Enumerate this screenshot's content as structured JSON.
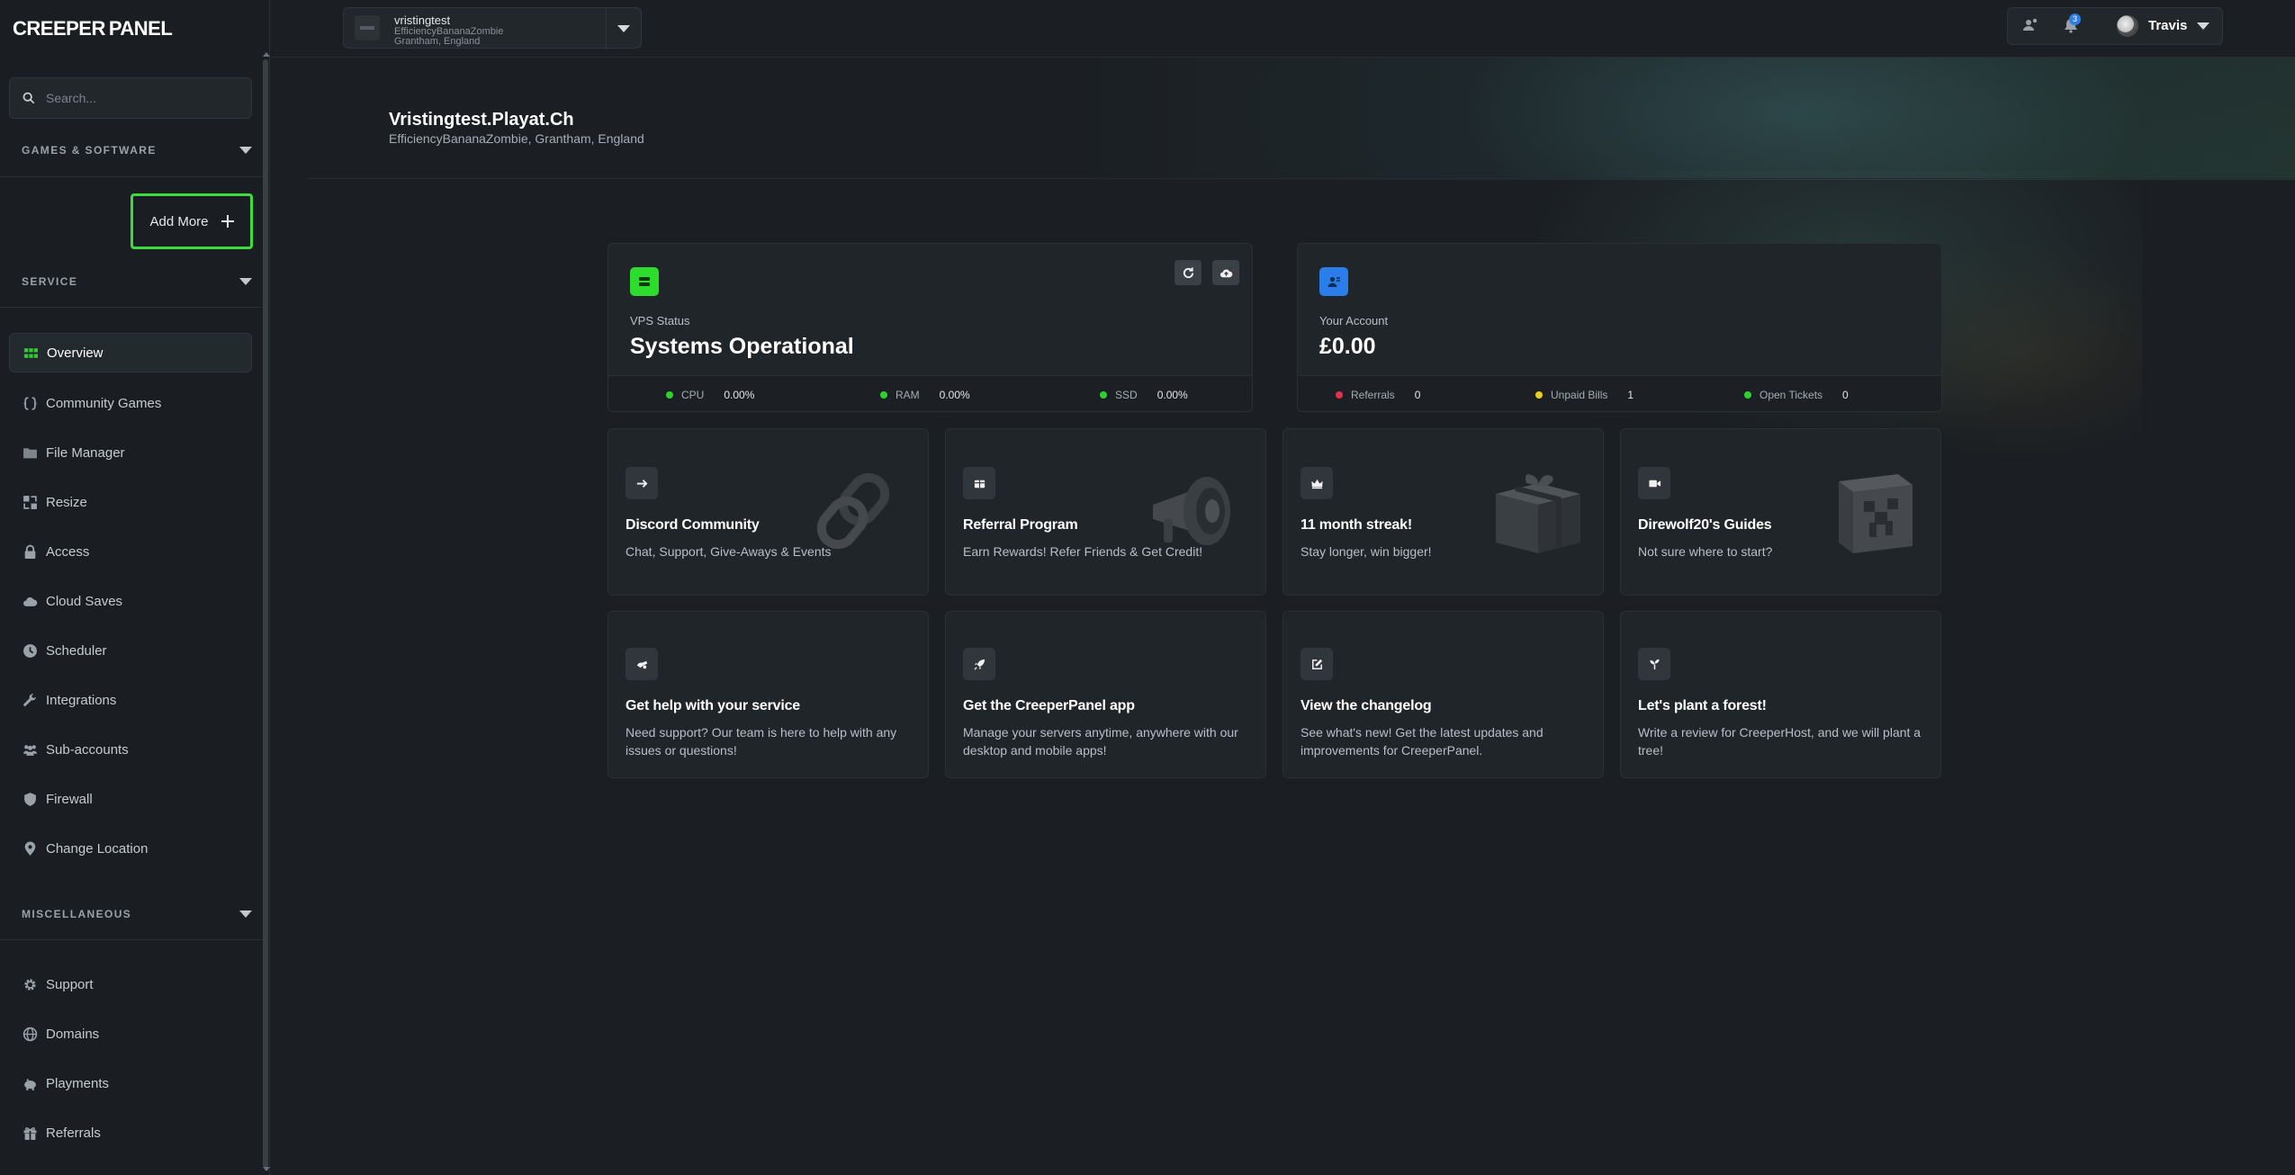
{
  "brand": {
    "logo_left": "CREEPER",
    "logo_right": "PANEL"
  },
  "colors": {
    "accent_green": "#3ddc3d",
    "accent_blue": "#2b7de9",
    "dot_green": "#2fd12f",
    "dot_red": "#e0304f",
    "dot_yellow": "#e7d11f"
  },
  "sidebar": {
    "search_placeholder": "Search...",
    "section_games": "GAMES & SOFTWARE",
    "add_more_label": "Add More",
    "section_service": "SERVICE",
    "service_items": [
      {
        "label": "Overview",
        "icon": "grid-icon"
      },
      {
        "label": "Community Games",
        "icon": "braces-icon"
      },
      {
        "label": "File Manager",
        "icon": "folder-icon"
      },
      {
        "label": "Resize",
        "icon": "resize-icon"
      },
      {
        "label": "Access",
        "icon": "lock-icon"
      },
      {
        "label": "Cloud Saves",
        "icon": "cloud-icon"
      },
      {
        "label": "Scheduler",
        "icon": "clock-icon"
      },
      {
        "label": "Integrations",
        "icon": "wrench-icon"
      },
      {
        "label": "Sub-accounts",
        "icon": "users-icon"
      },
      {
        "label": "Firewall",
        "icon": "shield-icon"
      },
      {
        "label": "Change Location",
        "icon": "pin-icon"
      }
    ],
    "section_misc": "MISCELLANEOUS",
    "misc_items": [
      {
        "label": "Support",
        "icon": "gear-icon"
      },
      {
        "label": "Domains",
        "icon": "globe-icon"
      },
      {
        "label": "Playments",
        "icon": "piggy-bank-icon"
      },
      {
        "label": "Referrals",
        "icon": "gift-icon"
      }
    ]
  },
  "topbar": {
    "server_name": "vristingtest",
    "server_sub1": "EfficiencyBananaZombie",
    "server_sub2": "Grantham, England",
    "notification_count": "3",
    "user_name": "Travis"
  },
  "header": {
    "title": "Vristingtest.Playat.Ch",
    "subtitle": "EfficiencyBananaZombie, Grantham, England"
  },
  "vps": {
    "label": "VPS Status",
    "value": "Systems Operational",
    "metrics": [
      {
        "name": "CPU",
        "value": "0.00%"
      },
      {
        "name": "RAM",
        "value": "0.00%"
      },
      {
        "name": "SSD",
        "value": "0.00%"
      }
    ]
  },
  "account": {
    "label": "Your Account",
    "value": "£0.00",
    "metrics": [
      {
        "name": "Referrals",
        "value": "0"
      },
      {
        "name": "Unpaid Bills",
        "value": "1"
      },
      {
        "name": "Open Tickets",
        "value": "0"
      }
    ]
  },
  "tiles": [
    {
      "title": "Discord Community",
      "desc": "Chat, Support, Give-Aways & Events",
      "icon": "arrow-right-icon"
    },
    {
      "title": "Referral Program",
      "desc": "Earn Rewards! Refer Friends & Get Credit!",
      "icon": "ticket-icon"
    },
    {
      "title": "11 month streak!",
      "desc": "Stay longer, win bigger!",
      "icon": "crown-icon"
    },
    {
      "title": "Direwolf20's Guides",
      "desc": "Not sure where to start?",
      "icon": "video-icon"
    },
    {
      "title": "Get help with your service",
      "desc": "Need support? Our team is here to help with any issues or questions!",
      "icon": "support-icon"
    },
    {
      "title": "Get the CreeperPanel app",
      "desc": "Manage your servers anytime, anywhere with our desktop and mobile apps!",
      "icon": "rocket-icon"
    },
    {
      "title": "View the changelog",
      "desc": "See what's new! Get the latest updates and improvements for CreeperPanel.",
      "icon": "edit-icon"
    },
    {
      "title": "Let's plant a forest!",
      "desc": "Write a review for CreeperHost, and we will plant a tree!",
      "icon": "sprout-icon"
    }
  ]
}
